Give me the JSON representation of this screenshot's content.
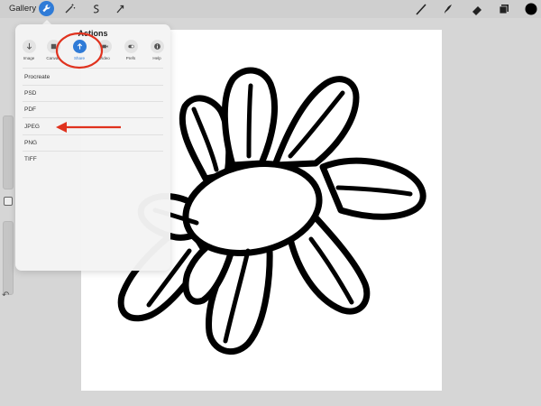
{
  "toolbar": {
    "gallery_label": "Gallery",
    "left_icons": [
      "wrench-icon",
      "magic-wand-icon",
      "selection-icon",
      "transform-arrow-icon"
    ],
    "right_icons": [
      "brush-icon",
      "smudge-icon",
      "eraser-icon",
      "layers-icon",
      "color-swatch"
    ],
    "active_color": "#000000",
    "accent": "#2f7bd7"
  },
  "actions_panel": {
    "title": "Actions",
    "tabs": [
      {
        "label": "Image",
        "icon": "add-icon"
      },
      {
        "label": "Canvas",
        "icon": "canvas-icon"
      },
      {
        "label": "Share",
        "icon": "share-icon",
        "active": true
      },
      {
        "label": "Video",
        "icon": "video-icon"
      },
      {
        "label": "Prefs",
        "icon": "toggle-icon"
      },
      {
        "label": "Help",
        "icon": "info-icon"
      }
    ],
    "export_items": [
      "Procreate",
      "PSD",
      "PDF",
      "JPEG",
      "PNG",
      "TIFF"
    ]
  },
  "annotations": {
    "circle_color": "#e0321e",
    "arrow_color": "#e0321e",
    "highlighted_tab": "Share",
    "highlighted_item": "JPEG"
  },
  "sidebar": {
    "undo_icon": "undo-icon"
  }
}
